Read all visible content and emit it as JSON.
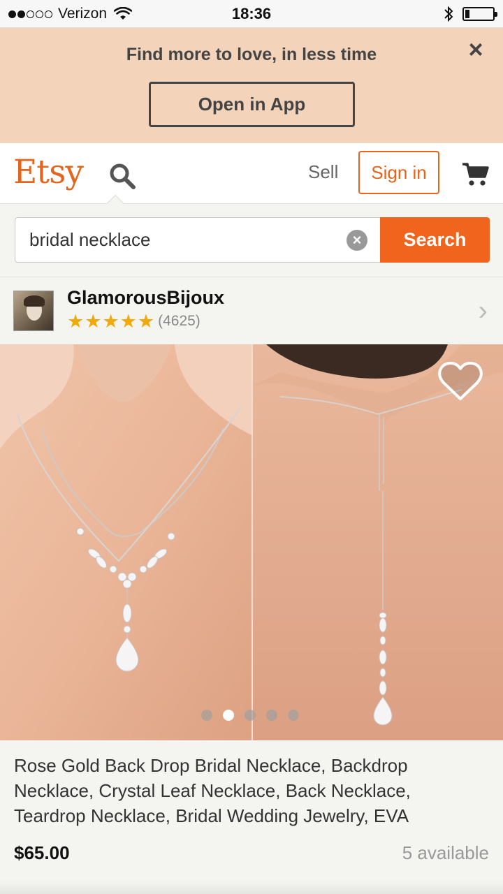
{
  "status_bar": {
    "carrier": "Verizon",
    "time": "18:36",
    "signal_bars_filled": 2,
    "signal_bars_total": 5,
    "battery_level": 0.15
  },
  "promo": {
    "text": "Find more to love, in less time",
    "close_icon": "×",
    "open_app_label": "Open in App"
  },
  "header": {
    "logo": "Etsy",
    "sell_label": "Sell",
    "signin_label": "Sign in",
    "icons": [
      "search-icon",
      "cart-icon"
    ]
  },
  "search": {
    "value": "bridal necklace",
    "clear_icon": "×",
    "button_label": "Search"
  },
  "shop": {
    "name": "GlamorousBijoux",
    "rating": 5,
    "star_glyph": "★",
    "review_count": "(4625)",
    "chevron": "›"
  },
  "gallery": {
    "image_count": 5,
    "active_index": 1
  },
  "product": {
    "title": "Rose Gold Back Drop Bridal Necklace, Backdrop Necklace, Crystal Leaf Necklace, Back Necklace, Teardrop Necklace, Bridal Wedding Jewelry, EVA",
    "price": "$65.00",
    "availability": "5 available"
  },
  "colors": {
    "brand": "#e5651e",
    "search_button": "#f1641e",
    "promo_bg": "#f3d4ba",
    "star": "#f1a90b"
  }
}
